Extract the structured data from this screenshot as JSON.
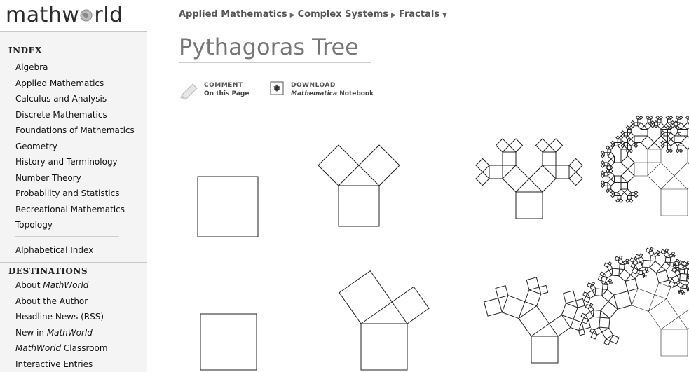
{
  "logo": {
    "text_pre": "mathw",
    "text_post": "rld"
  },
  "sidebar": {
    "index_title": "INDEX",
    "index_items": [
      "Algebra",
      "Applied Mathematics",
      "Calculus and Analysis",
      "Discrete Mathematics",
      "Foundations of Mathematics",
      "Geometry",
      "History and Terminology",
      "Number Theory",
      "Probability and Statistics",
      "Recreational Mathematics",
      "Topology"
    ],
    "alphabetical": "Alphabetical Index",
    "destinations_title": "DESTINATIONS",
    "destinations": {
      "about_pre": "About ",
      "about_em": "MathWorld",
      "author": "About the Author",
      "headline": "Headline News (RSS)",
      "new_pre": "New in ",
      "new_em": "MathWorld",
      "classroom_em": "MathWorld",
      "classroom_post": " Classroom",
      "interactive": "Interactive Entries"
    }
  },
  "breadcrumb": {
    "items": [
      "Applied Mathematics",
      "Complex Systems",
      "Fractals"
    ],
    "separator": "▶",
    "dropdown": "▼"
  },
  "page": {
    "title": "Pythagoras Tree"
  },
  "actions": {
    "comment_label": "COMMENT",
    "comment_sub": "On this Page",
    "download_label": "DOWNLOAD",
    "download_em": "Mathematica",
    "download_post": " Notebook"
  },
  "colors": {
    "sidebar_bg": "#f4f4f4",
    "title": "#777777",
    "stroke": "#222222"
  },
  "figures": {
    "rows": [
      {
        "angle_deg": 45,
        "depths": [
          1,
          2,
          4,
          8
        ]
      },
      {
        "angle_deg": 35,
        "depths": [
          1,
          2,
          4,
          8
        ]
      }
    ]
  }
}
